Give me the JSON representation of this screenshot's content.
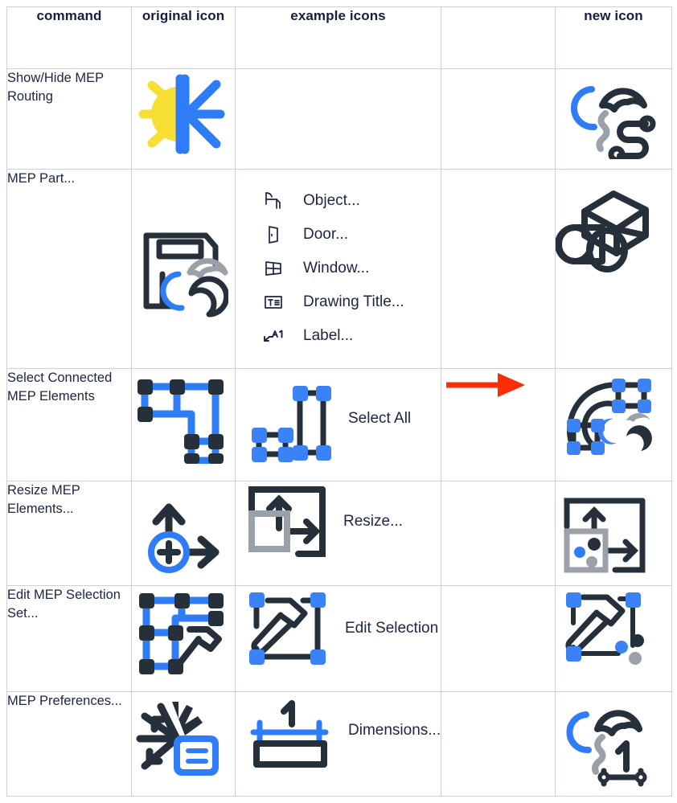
{
  "table": {
    "headers": [
      {
        "label": "command",
        "name": "header-command"
      },
      {
        "label": "original icon",
        "name": "header-original-icon"
      },
      {
        "label": "example icons",
        "name": "header-example-icons"
      },
      {
        "label": "",
        "name": "header-arrow-spacer"
      },
      {
        "label": "new icon",
        "name": "header-new-icon"
      }
    ],
    "rows": [
      {
        "command": "Show/Hide MEP Routing",
        "original_icon": "sun-burst-split-icon",
        "examples": [],
        "new_icon": "crescents-routing-path-icon"
      },
      {
        "command": "MEP Part...",
        "original_icon": "chair-with-beans-icon",
        "examples": [
          {
            "label": "Object...",
            "icon": "chair-icon"
          },
          {
            "label": "Door...",
            "icon": "door-icon"
          },
          {
            "label": "Window...",
            "icon": "window-icon"
          },
          {
            "label": "Drawing Title...",
            "icon": "drawing-title-icon"
          },
          {
            "label": "Label...",
            "icon": "label-a1-icon"
          }
        ],
        "new_icon": "duct-box-cylinders-icon"
      },
      {
        "command": "Select Connected MEP Elements",
        "original_icon": "blue-routing-grid-nodes-icon",
        "examples": [
          {
            "label": "Select All",
            "icon": "select-all-handles-icon"
          }
        ],
        "new_icon": "elbow-pipe-selection-beans-icon"
      },
      {
        "command": "Resize MEP Elements...",
        "original_icon": "circle-plus-arrows-icon",
        "examples": [
          {
            "label": "Resize...",
            "icon": "resize-box-arrows-icon"
          }
        ],
        "new_icon": "resize-box-dots-icon"
      },
      {
        "command": "Edit MEP Selection Set...",
        "original_icon": "blue-grid-hammer-icon",
        "examples": [
          {
            "label": "Edit Selection",
            "icon": "hammer-selection-handles-icon"
          }
        ],
        "new_icon": "hammer-handles-dots-icon"
      },
      {
        "command": "MEP Preferences...",
        "original_icon": "burst-settings-panel-icon",
        "examples": [
          {
            "label": "Dimensions...",
            "icon": "dimension-line-rect-icon"
          }
        ],
        "new_icon": "crescents-dimension-one-icon"
      }
    ],
    "arrow": {
      "name": "red-right-arrow",
      "symbol": "→"
    }
  },
  "colors": {
    "header_bg": "#f2f4f7",
    "border": "#cbd2de",
    "text": "#1c2541",
    "accent_blue": "#2f7df6",
    "dark": "#25303a",
    "gray": "#9aa1a8",
    "yellow": "#f8df33",
    "red_arrow": "#fa2d06"
  }
}
